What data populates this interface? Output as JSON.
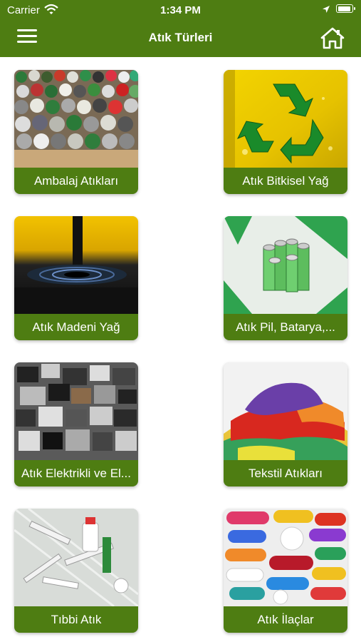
{
  "status_bar": {
    "carrier": "Carrier",
    "time": "1:34 PM"
  },
  "nav": {
    "title": "Atık Türleri"
  },
  "tiles": [
    {
      "label": "Ambalaj Atıkları"
    },
    {
      "label": "Atık Bitkisel Yağ"
    },
    {
      "label": "Atık Madeni Yağ"
    },
    {
      "label": "Atık Pil, Batarya,..."
    },
    {
      "label": "Atık Elektrikli ve El..."
    },
    {
      "label": "Tekstil Atıkları"
    },
    {
      "label": "Tıbbi Atık"
    },
    {
      "label": "Atık İlaçlar"
    }
  ],
  "colors": {
    "header": "#4e7d12",
    "label_bg": "#4e7d12",
    "label_text": "#ffffff"
  }
}
